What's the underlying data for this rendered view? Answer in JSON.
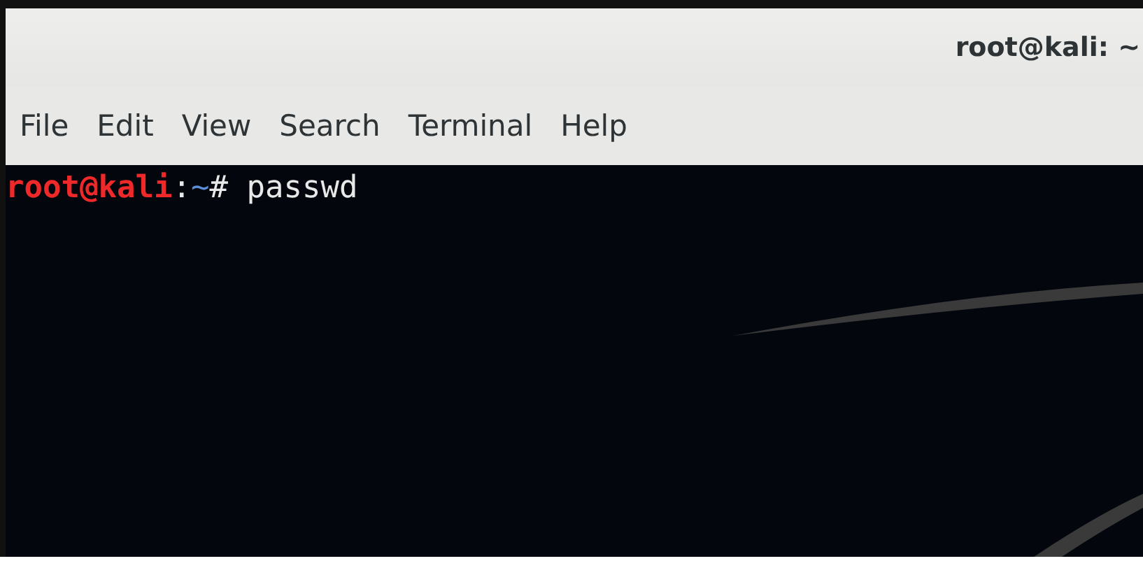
{
  "window": {
    "title": "root@kali: ~"
  },
  "menu": [
    "File",
    "Edit",
    "View",
    "Search",
    "Terminal",
    "Help"
  ],
  "terminal": {
    "lines": [
      {
        "user_host": "root@kali",
        "separator": ":",
        "path": "~",
        "symbol": "#",
        "command": "passwd"
      }
    ]
  }
}
